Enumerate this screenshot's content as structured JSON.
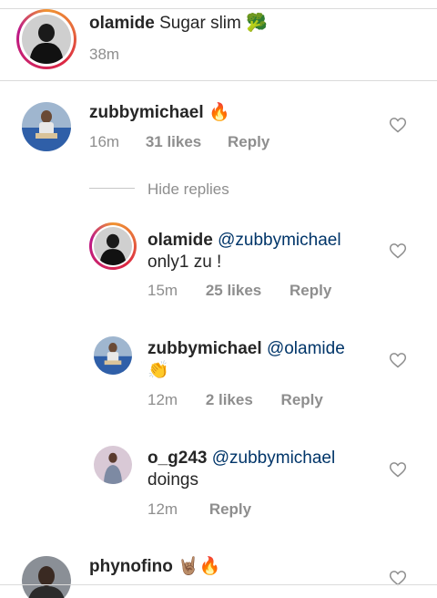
{
  "comments": [
    {
      "username": "olamide",
      "text": "Sugar slim",
      "emoji": "🥦",
      "time": "38m"
    },
    {
      "username": "zubbymichael",
      "text": "",
      "emoji": "🔥",
      "time": "16m",
      "likes": "31 likes",
      "reply_label": "Reply"
    },
    {
      "username": "phynofino",
      "emoji": "🤘🏽🔥"
    }
  ],
  "hide_replies_label": "Hide replies",
  "replies": [
    {
      "username": "olamide",
      "mention": "@zubbymichael",
      "text": "only1 zu !",
      "time": "15m",
      "likes": "25 likes",
      "reply_label": "Reply"
    },
    {
      "username": "zubbymichael",
      "mention": "@olamide",
      "emoji": "👏",
      "time": "12m",
      "likes": "2 likes",
      "reply_label": "Reply"
    },
    {
      "username": "o_g243",
      "mention": "@zubbymichael",
      "text": "doings",
      "time": "12m",
      "reply_label": "Reply"
    }
  ],
  "icons": {
    "like": "heart-outline-icon",
    "avatar": "user-avatar"
  },
  "colors": {
    "mention": "#003569",
    "meta": "#8e8e8e",
    "divider": "#dbdbdb"
  }
}
